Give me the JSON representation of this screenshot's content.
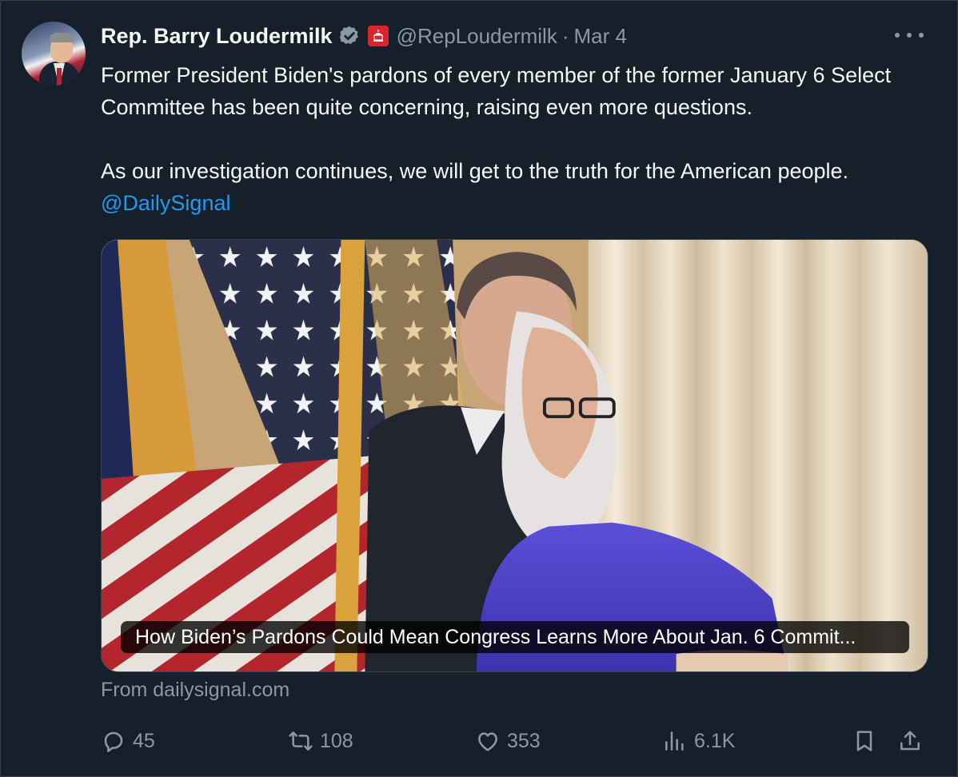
{
  "author": {
    "name": "Rep. Barry Loudermilk",
    "handle": "@RepLoudermilk",
    "separator": "·",
    "date": "Mar 4"
  },
  "tweet": {
    "paragraph1": "Former President Biden's pardons of every member of the former January 6 Select Committee has been quite concerning, raising even more questions.",
    "paragraph2_text": "As our investigation continues, we will get to the truth for the American people. ",
    "mention": "@DailySignal"
  },
  "card": {
    "title": "How Biden’s Pardons Could Mean Congress Learns More About Jan. 6 Commit...",
    "source": "From dailysignal.com"
  },
  "actions": {
    "replies": "45",
    "reposts": "108",
    "likes": "353",
    "views": "6.1K"
  },
  "colors": {
    "background": "#15202b",
    "text": "#f7f9f9",
    "secondary": "#8b98a5",
    "link": "#1d9bf0",
    "verified": "#8b98a5",
    "gov_badge": "#d9262e"
  },
  "icons": [
    "verified-badge-icon",
    "government-badge-icon",
    "more-icon",
    "reply-icon",
    "repost-icon",
    "like-icon",
    "views-icon",
    "bookmark-icon",
    "share-icon"
  ]
}
